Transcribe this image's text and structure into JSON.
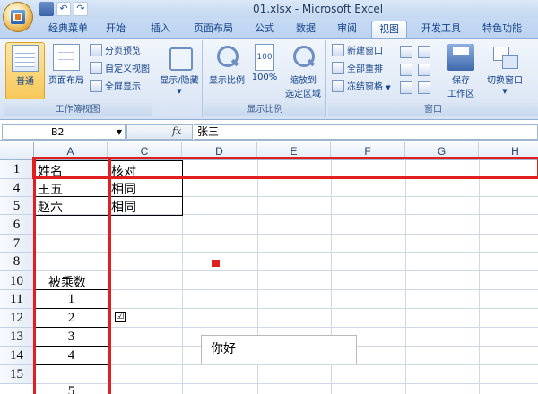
{
  "window": {
    "title": "01.xlsx - Microsoft Excel"
  },
  "tabs": [
    "经典菜单",
    "开始",
    "插入",
    "页面布局",
    "公式",
    "数据",
    "审阅",
    "视图",
    "开发工具",
    "特色功能"
  ],
  "active_tab": "视图",
  "ribbon": {
    "groups": {
      "workbook_views": {
        "label": "工作簿视图",
        "normal": "普通",
        "page_layout": "页面布局",
        "page_break": "分页预览",
        "custom_views": "自定义视图",
        "full_screen": "全屏显示"
      },
      "show_hide": {
        "label": "显示/隐藏"
      },
      "zoom": {
        "label": "显示比例",
        "zoom": "显示比例",
        "zoom100": "100%",
        "zoom_selection_l1": "缩放到",
        "zoom_selection_l2": "选定区域"
      },
      "window": {
        "label": "窗口",
        "new_window": "新建窗口",
        "arrange_all": "全部重排",
        "freeze_panes": "冻结窗格",
        "save_workspace_l1": "保存",
        "save_workspace_l2": "工作区",
        "switch_windows": "切换窗口"
      }
    }
  },
  "formula_bar": {
    "name_box": "B2",
    "fx": "fx",
    "content": "张三"
  },
  "columns": [
    "A",
    "C",
    "D",
    "E",
    "F",
    "G",
    "H"
  ],
  "rows": [
    "1",
    "4",
    "5",
    "6",
    "7",
    "8",
    "10",
    "11",
    "12",
    "13",
    "14",
    "15"
  ],
  "cells": {
    "a1": "姓名",
    "c1": "核对",
    "a4": "王五",
    "c4": "相同",
    "a5": "赵六",
    "c5": "相同",
    "a10": "被乘数",
    "a11": "1",
    "a12": "2",
    "a13": "3",
    "a14": "4",
    "a15": "5"
  },
  "checkbox": {
    "checked_glyph": "☑"
  },
  "textbox": {
    "text": "你好"
  },
  "colors": {
    "annotation_red": "#e02020",
    "ribbon_accent": "#15428b"
  }
}
